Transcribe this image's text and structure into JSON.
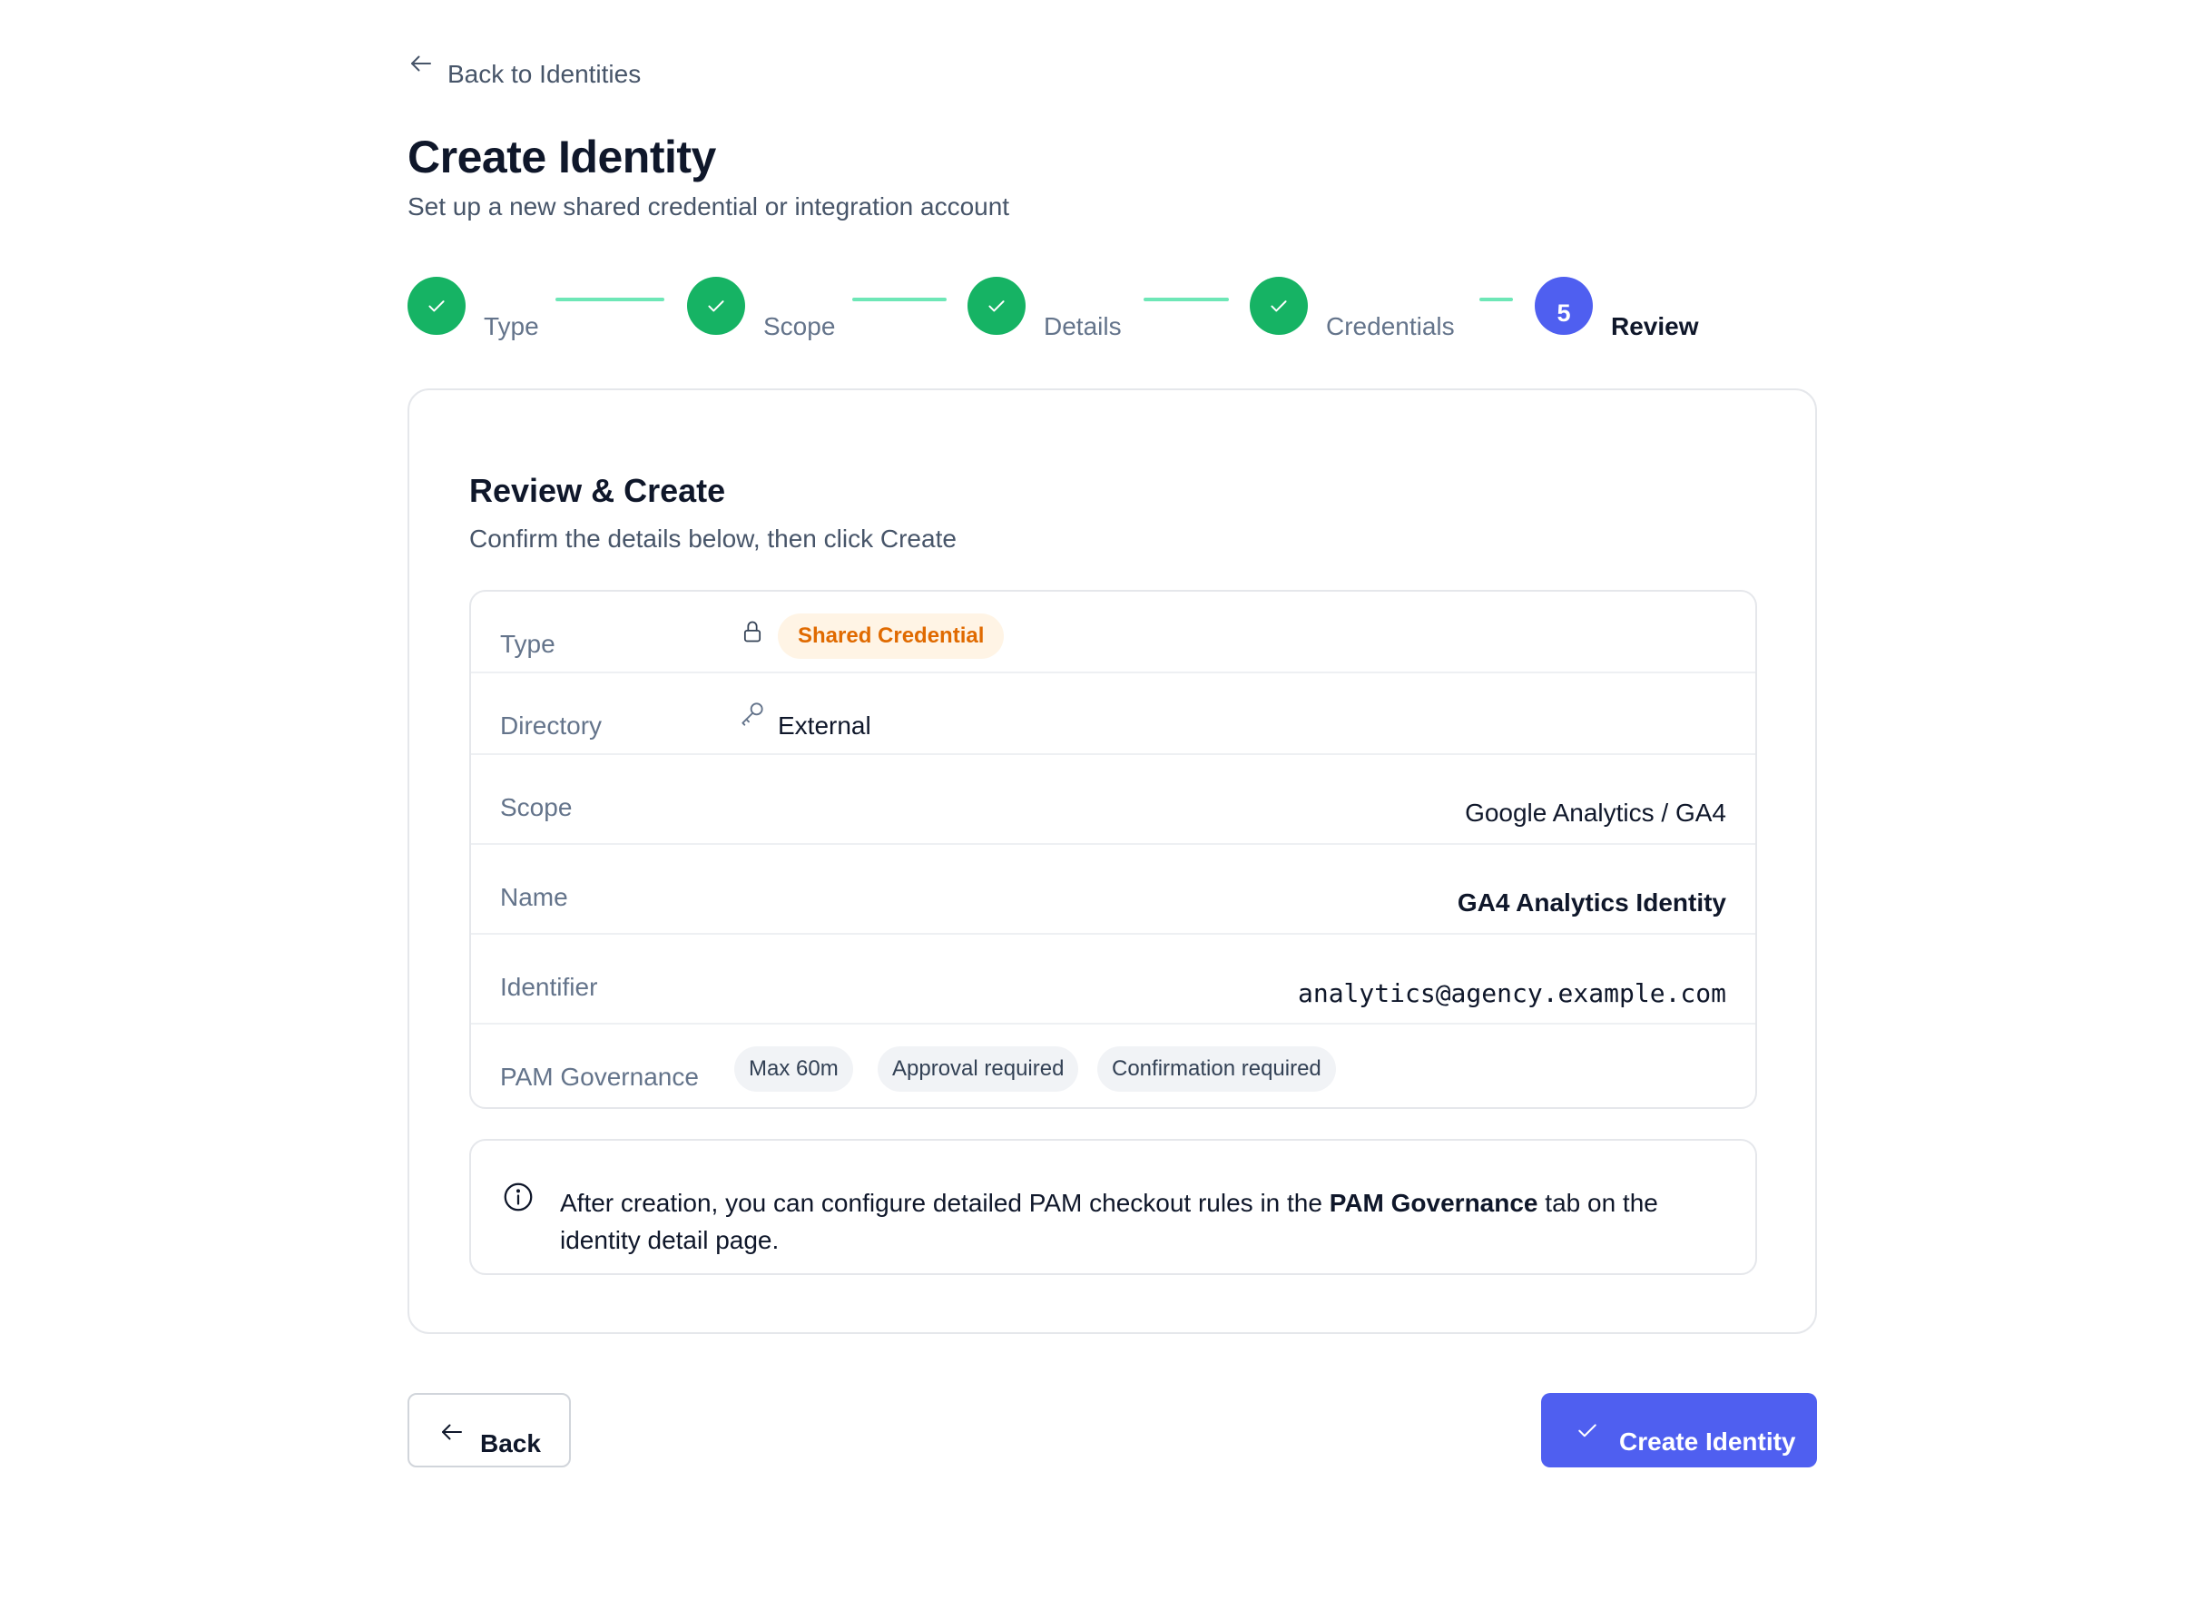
{
  "nav": {
    "back_label": "Back to Identities"
  },
  "header": {
    "title": "Create Identity",
    "subtitle": "Set up a new shared credential or integration account"
  },
  "stepper": {
    "steps": [
      {
        "label": "Type",
        "state": "done"
      },
      {
        "label": "Scope",
        "state": "done"
      },
      {
        "label": "Details",
        "state": "done"
      },
      {
        "label": "Credentials",
        "state": "done"
      },
      {
        "label": "Review",
        "state": "active",
        "number": "5"
      }
    ]
  },
  "review": {
    "title": "Review & Create",
    "subtitle": "Confirm the details below, then click Create",
    "rows": {
      "type": {
        "label": "Type",
        "value": "Shared Credential",
        "icon": "lock-icon"
      },
      "directory": {
        "label": "Directory",
        "value": "External",
        "icon": "key-icon"
      },
      "scope": {
        "label": "Scope",
        "value": "Google Analytics / GA4"
      },
      "name": {
        "label": "Name",
        "value": "GA4 Analytics Identity"
      },
      "identifier": {
        "label": "Identifier",
        "value": "analytics@agency.example.com"
      },
      "pam": {
        "label": "PAM Governance",
        "pills": [
          "Max 60m",
          "Approval required",
          "Confirmation required"
        ]
      }
    }
  },
  "info": {
    "text_before": "After creation, you can configure detailed PAM checkout rules in the ",
    "text_bold": "PAM Governance",
    "text_after": " tab on the identity detail page."
  },
  "footer": {
    "back_label": "Back",
    "create_label": "Create Identity"
  },
  "colors": {
    "accent": "#4f5ff0",
    "success": "#16b364",
    "success_line": "#6ee7b7",
    "badge_orange_text": "#e06a00",
    "badge_orange_bg": "#fff4e5"
  }
}
